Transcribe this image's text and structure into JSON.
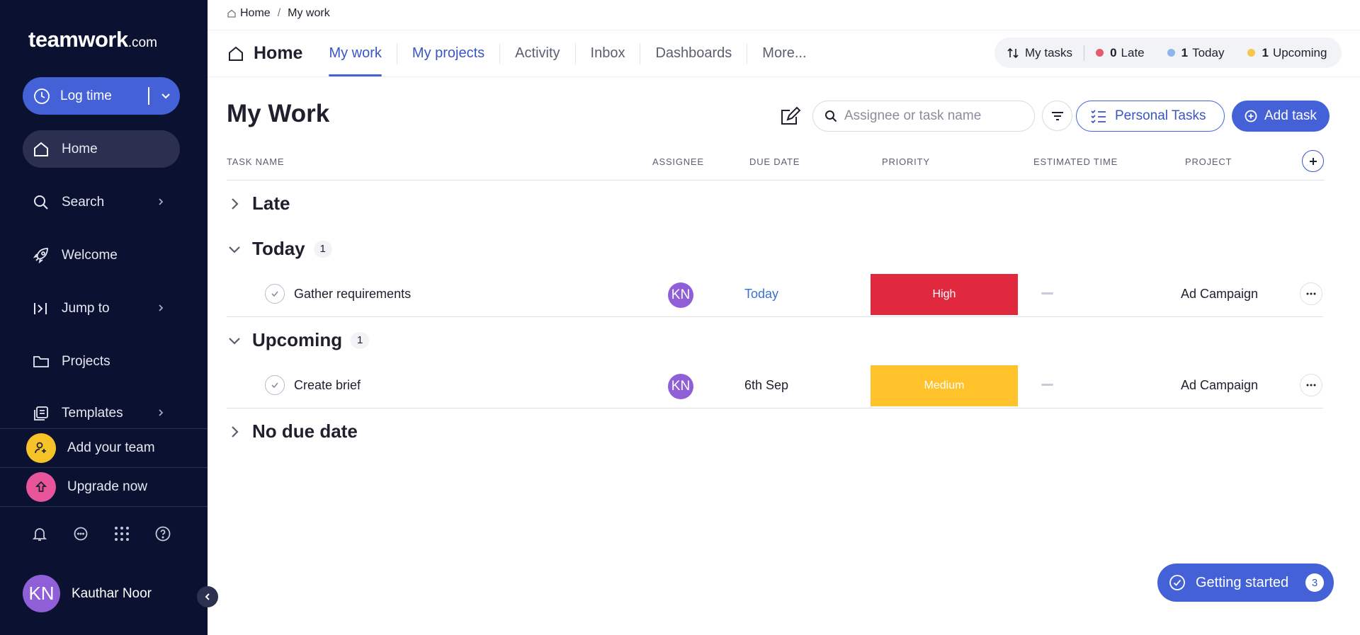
{
  "sidebar": {
    "logo_text": "teamwork",
    "logo_suffix": ".com",
    "log_time_label": "Log time",
    "items": [
      {
        "label": "Home",
        "icon": "home-icon"
      },
      {
        "label": "Search",
        "icon": "search-icon"
      },
      {
        "label": "Welcome",
        "icon": "rocket-icon"
      },
      {
        "label": "Jump to",
        "icon": "jump-to-icon"
      },
      {
        "label": "Projects",
        "icon": "folder-icon"
      },
      {
        "label": "Templates",
        "icon": "templates-icon"
      }
    ],
    "add_team_label": "Add your team",
    "upgrade_label": "Upgrade now",
    "user_initials": "KN",
    "user_name": "Kauthar Noor"
  },
  "breadcrumb": {
    "home": "Home",
    "current": "My work"
  },
  "tabs": {
    "home_title": "Home",
    "items": [
      "My work",
      "My projects",
      "Activity",
      "Inbox",
      "Dashboards",
      "More..."
    ]
  },
  "stats": {
    "my_tasks_label": "My tasks",
    "late_count": "0",
    "late_label": "Late",
    "today_count": "1",
    "today_label": "Today",
    "upcoming_count": "1",
    "upcoming_label": "Upcoming"
  },
  "page": {
    "title": "My Work",
    "search_placeholder": "Assignee or task name",
    "personal_tasks_label": "Personal Tasks",
    "add_task_label": "Add task"
  },
  "columns": [
    "TASK NAME",
    "ASSIGNEE",
    "DUE DATE",
    "PRIORITY",
    "ESTIMATED TIME",
    "PROJECT"
  ],
  "groups": [
    {
      "name": "Late"
    },
    {
      "name": "Today",
      "count": "1"
    },
    {
      "name": "Upcoming",
      "count": "1"
    },
    {
      "name": "No due date"
    }
  ],
  "tasks": [
    {
      "name": "Gather requirements",
      "assignee": "KN",
      "due": "Today",
      "priority": "High",
      "project": "Ad Campaign"
    },
    {
      "name": "Create brief",
      "assignee": "KN",
      "due": "6th Sep",
      "priority": "Medium",
      "project": "Ad Campaign"
    }
  ],
  "getting_started": {
    "label": "Getting started",
    "count": "3"
  },
  "colors": {
    "sidebar_bg": "#0b1131",
    "accent": "#4461d7",
    "late_dot": "#e25b6f",
    "today_dot": "#8fb6e8",
    "upcoming_dot": "#f5c74c",
    "high": "#e0293e",
    "medium": "#ffc22b",
    "add_team": "#f5c227",
    "upgrade": "#e9559a"
  }
}
